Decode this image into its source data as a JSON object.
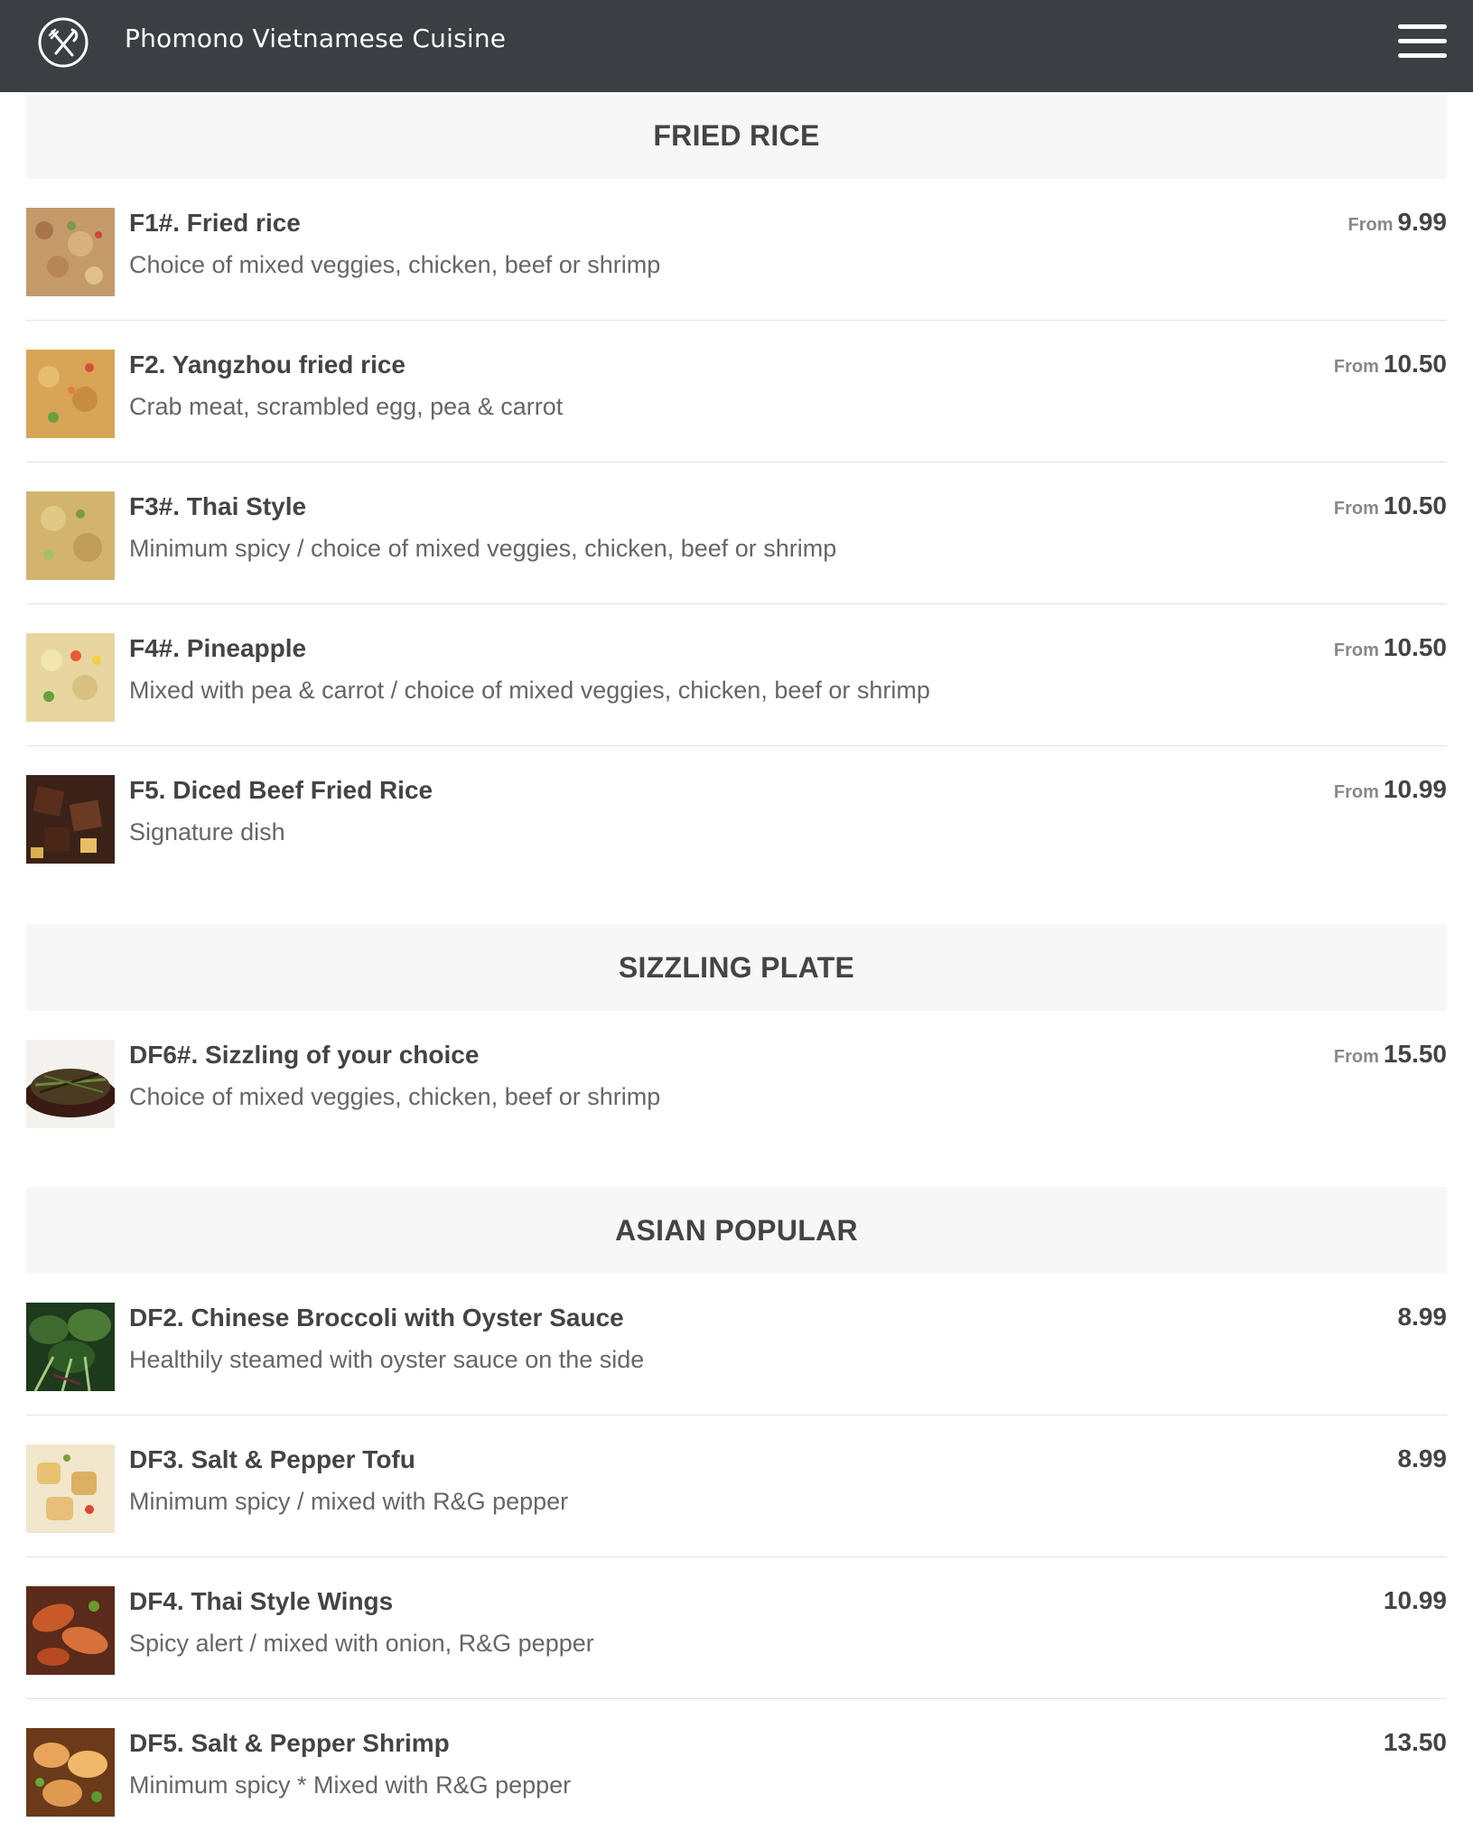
{
  "header": {
    "title": "Phomono Vietnamese Cuisine",
    "logo_icon": "fork-knife-icon",
    "menu_icon": "hamburger-menu-icon",
    "background_color": "#3b3e43"
  },
  "sections": [
    {
      "title": "FRIED RICE",
      "items": [
        {
          "name": "F1#. Fried rice",
          "desc": "Choice of mixed veggies, chicken, beef or shrimp",
          "from": "From",
          "price": "9.99"
        },
        {
          "name": "F2. Yangzhou fried rice",
          "desc": "Crab meat, scrambled egg, pea & carrot",
          "from": "From",
          "price": "10.50"
        },
        {
          "name": "F3#. Thai Style",
          "desc": "Minimum spicy / choice of mixed veggies, chicken, beef or shrimp",
          "from": "From",
          "price": "10.50"
        },
        {
          "name": "F4#. Pineapple",
          "desc": "Mixed with pea & carrot / choice of mixed veggies, chicken, beef or shrimp",
          "from": "From",
          "price": "10.50"
        },
        {
          "name": "F5. Diced Beef Fried Rice",
          "desc": "Signature dish",
          "from": "From",
          "price": "10.99"
        }
      ]
    },
    {
      "title": "SIZZLING PLATE",
      "items": [
        {
          "name": "DF6#. Sizzling of your choice",
          "desc": "Choice of mixed veggies, chicken, beef or shrimp",
          "from": "From",
          "price": "15.50"
        }
      ]
    },
    {
      "title": "ASIAN POPULAR",
      "items": [
        {
          "name": "DF2. Chinese Broccoli with Oyster Sauce",
          "desc": "Healthily steamed with oyster sauce on the side",
          "price": "8.99"
        },
        {
          "name": "DF3. Salt & Pepper Tofu",
          "desc": "Minimum spicy / mixed with R&G pepper",
          "price": "8.99"
        },
        {
          "name": "DF4. Thai Style Wings",
          "desc": "Spicy alert / mixed with onion, R&G pepper",
          "price": "10.99"
        },
        {
          "name": "DF5. Salt & Pepper Shrimp",
          "desc": "Minimum spicy * Mixed with R&G pepper",
          "price": "13.50"
        }
      ]
    }
  ]
}
